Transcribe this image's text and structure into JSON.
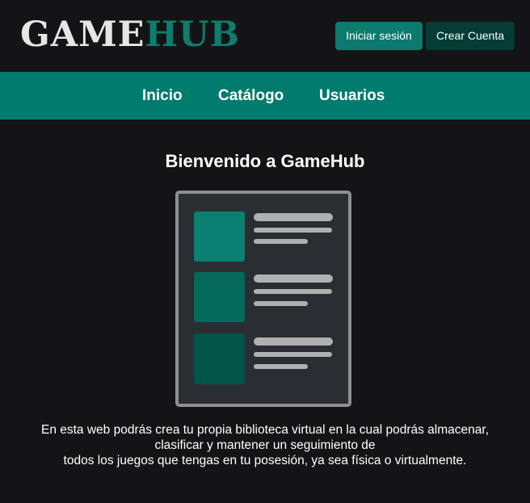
{
  "header": {
    "logo_part1": "GAME",
    "logo_part2": "HUB",
    "login_label": "Iniciar sesión",
    "register_label": "Crear Cuenta"
  },
  "nav": {
    "items": [
      {
        "label": "Inicio"
      },
      {
        "label": "Catálogo"
      },
      {
        "label": "Usuarios"
      }
    ]
  },
  "main": {
    "title": "Bienvenido a GameHub",
    "illustration_icon": "library-list-icon",
    "description_lines": [
      "En esta web podrás crea tu propia biblioteca virtual en la cual podrás almacenar,",
      "clasificar y mantener un seguimiento de",
      "todos los juegos que tengas en tu posesión, ya sea física o virtualmente."
    ]
  },
  "colors": {
    "background": "#141416",
    "accent": "#017b6d",
    "login_button": "#0c7a6c",
    "register_button": "#043d36",
    "logo_hub": "#0e7d6e"
  }
}
